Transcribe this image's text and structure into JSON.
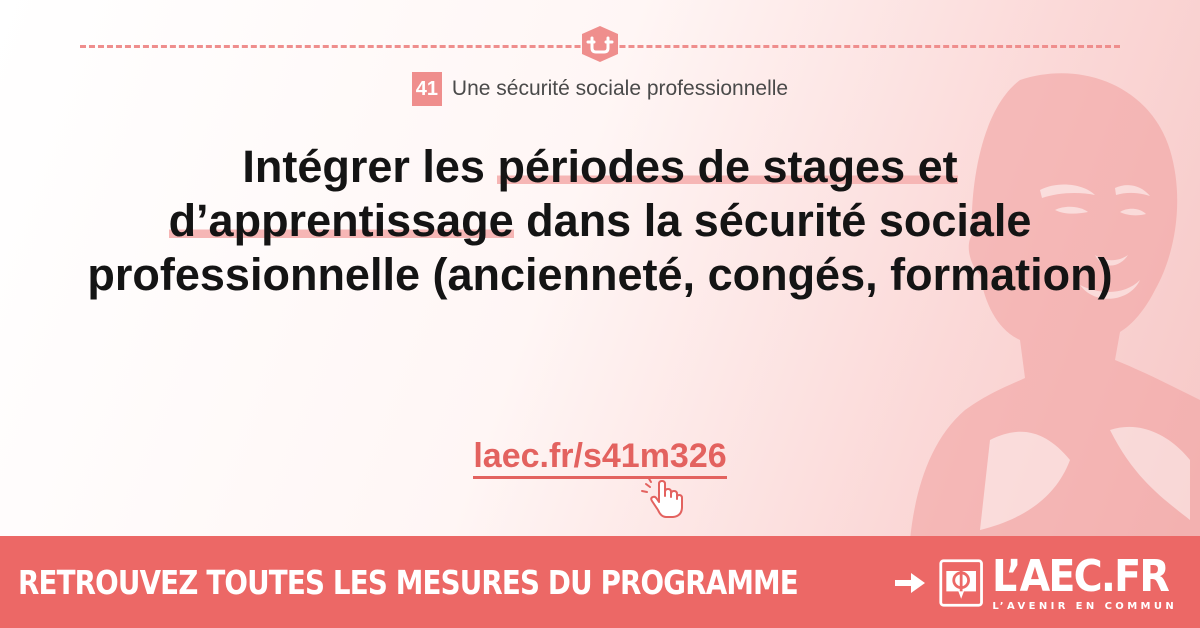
{
  "measure": {
    "number": "41",
    "category": "Une sécurité sociale professionnelle"
  },
  "headline": {
    "part1": "Intégrer les ",
    "highlight1": "périodes de stages et",
    "highlight2": "d’apprentissage",
    "part2": " dans la sécurité sociale professionnelle (ancienneté, congés, formation)"
  },
  "short_link": "laec.fr/s41m326",
  "banner": {
    "cta": "RETROUVEZ TOUTES LES MESURES DU PROGRAMME",
    "brand_name": "L’AEC.FR",
    "brand_tagline": "L’AVENIR EN COMMUN"
  },
  "colors": {
    "accent": "#ec6866",
    "highlight": "#f6b6b5",
    "text": "#141414"
  },
  "icons": [
    "portrait-illustration",
    "handshake-icon",
    "hand-pointer-icon",
    "arrow-right-icon",
    "phi-logo-icon"
  ]
}
